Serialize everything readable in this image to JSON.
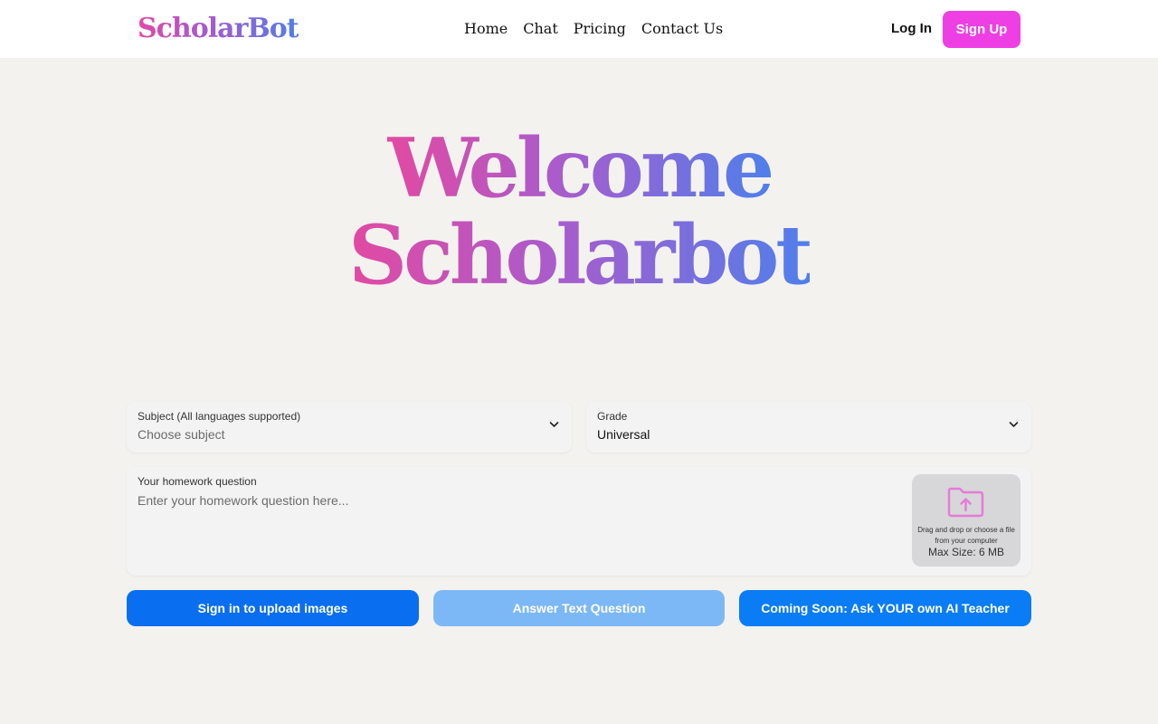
{
  "header": {
    "logo": "ScholarBot",
    "nav": [
      "Home",
      "Chat",
      "Pricing",
      "Contact Us"
    ],
    "login_label": "Log In",
    "signup_label": "Sign Up"
  },
  "hero": {
    "line1": "Welcome",
    "line2": "Scholarbot"
  },
  "form": {
    "subject": {
      "label": "Subject (All languages supported)",
      "placeholder": "Choose subject"
    },
    "grade": {
      "label": "Grade",
      "value": "Universal"
    },
    "question": {
      "label": "Your homework question",
      "placeholder": "Enter your homework question here..."
    },
    "upload": {
      "text": "Drag and drop or choose a file from your computer",
      "max_size": "Max Size: 6 MB"
    }
  },
  "actions": {
    "upload_images": "Sign in to upload images",
    "answer_text": "Answer Text Question",
    "ai_teacher": "Coming Soon: Ask YOUR own AI Teacher"
  },
  "colors": {
    "brand_pink": "#ee3fe4",
    "primary_blue": "#0a6ef0",
    "disabled_blue": "#7db8f6",
    "gradient_start": "#e24aa2",
    "gradient_end": "#4f7feb"
  }
}
